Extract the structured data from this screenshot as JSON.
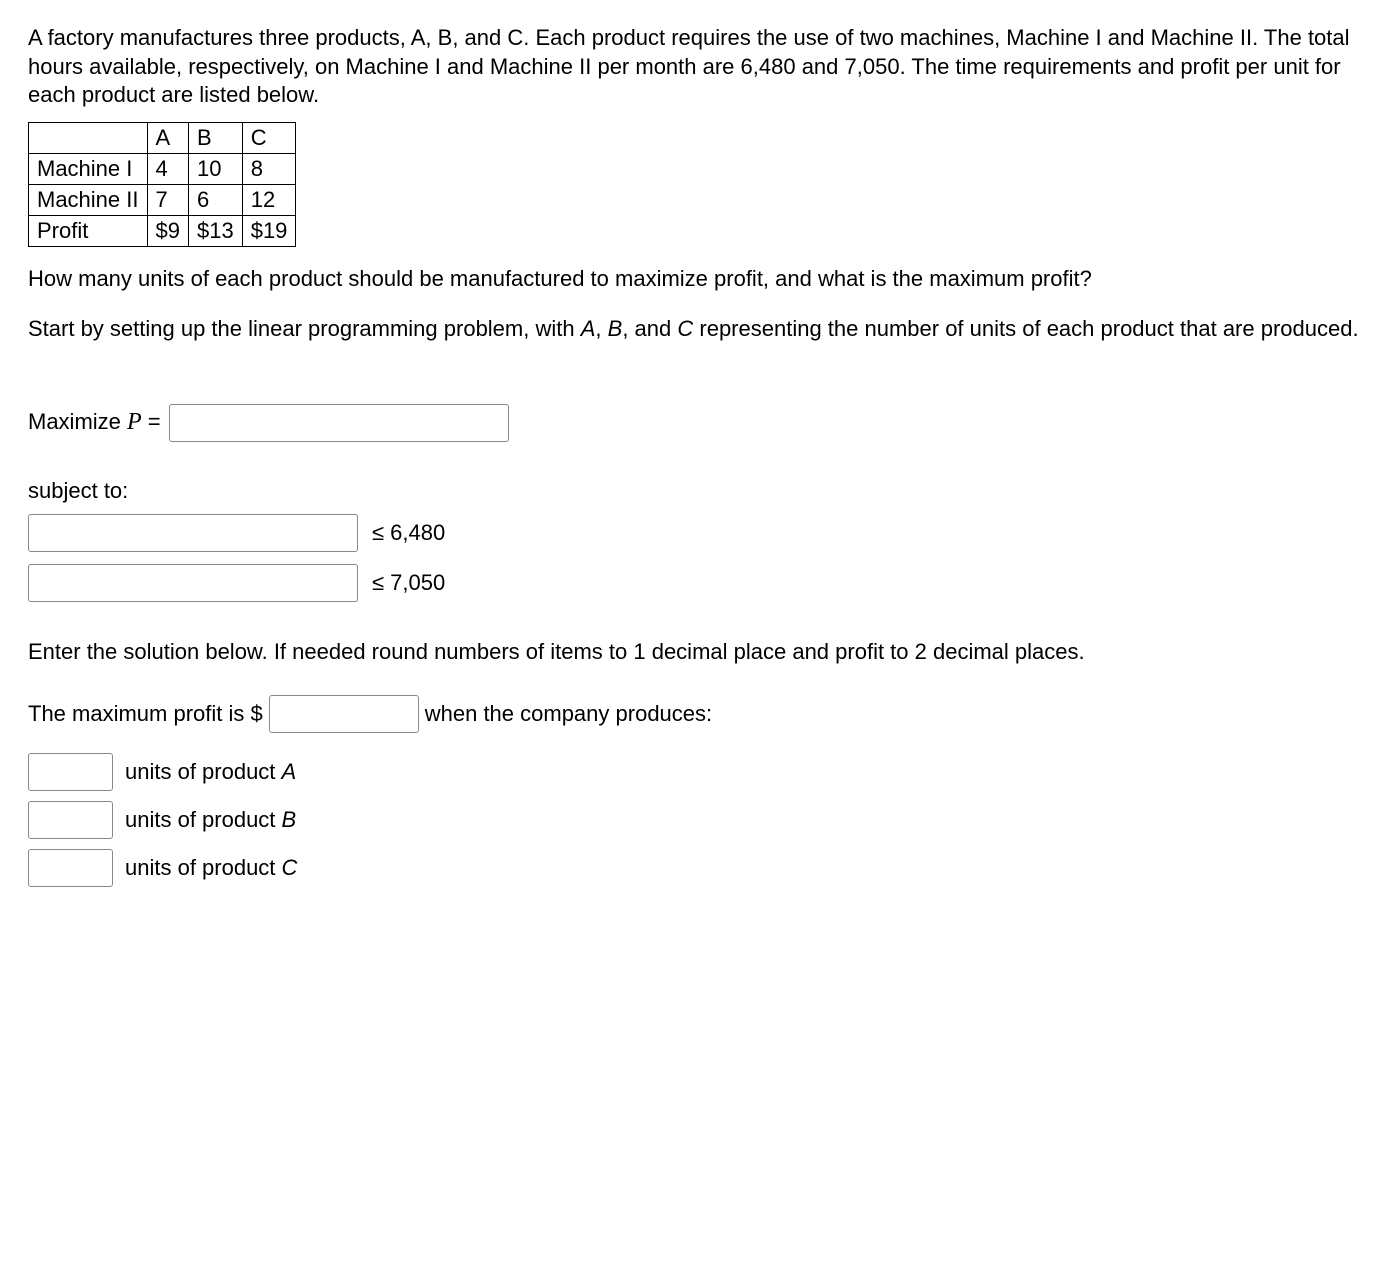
{
  "problem": "A factory manufactures three products, A, B, and C. Each product requires the use of two machines, Machine I and Machine II. The total hours available, respectively, on Machine I and Machine II per month are 6,480 and 7,050. The time requirements and profit per unit for each product are listed below.",
  "table": {
    "headers": [
      "",
      "A",
      "B",
      "C"
    ],
    "rows": [
      [
        "Machine I",
        "4",
        "10",
        "8"
      ],
      [
        "Machine II",
        "7",
        "6",
        "12"
      ],
      [
        "Profit",
        "$9",
        "$13",
        "$19"
      ]
    ]
  },
  "question": "How many units of each product should be manufactured to maximize profit, and what is the maximum profit?",
  "instruction_prefix": "Start by setting up the linear programming problem, with ",
  "instruction_suffix": " representing the number of units of each product that are produced.",
  "varA": "A",
  "varB": "B",
  "varC": "C",
  "comma": ", ",
  "and": ", and ",
  "maximize_label": "Maximize ",
  "P_var": "P",
  "equals": " = ",
  "subject_to": "subject to:",
  "constraints": [
    "≤ 6,480",
    "≤ 7,050"
  ],
  "solution_instr": "Enter the solution below. If needed round numbers of items to 1 decimal place and profit to 2 decimal places.",
  "profit_prefix": "The maximum profit is $",
  "profit_suffix": " when the company produces:",
  "units_A": " units of product ",
  "units_B": " units of product ",
  "units_C": " units of product "
}
